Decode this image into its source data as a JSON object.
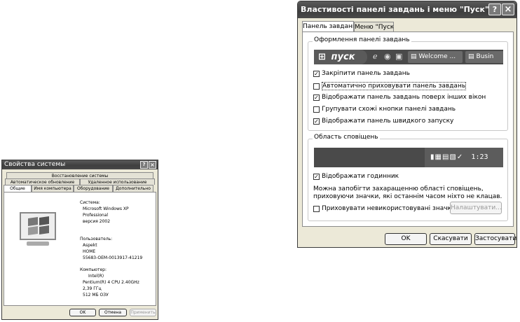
{
  "system_dialog": {
    "title": "Свойства системы",
    "title_buttons": {
      "help": "?",
      "close": "×"
    },
    "tabs_row1": [
      "Восстановление системы"
    ],
    "tabs_row2": [
      "Автоматическое обновление",
      "Удаленное использование"
    ],
    "tabs_row3": [
      "Общие",
      "Имя компьютера",
      "Оборудование",
      "Дополнительно"
    ],
    "system": {
      "heading": "Система:",
      "lines": [
        "Microsoft Windows XP",
        "Professional",
        "версия 2002"
      ]
    },
    "user": {
      "heading": "Пользователь:",
      "lines": [
        "Aspekt",
        "HOME",
        "55683-OEM-0013917-41219"
      ]
    },
    "computer": {
      "heading": "Компьютер:",
      "lines": [
        "Intel(R)",
        "Pentium(R) 4 CPU 2.40GHz",
        "2,39 ГГц",
        "512 МБ ОЗУ"
      ]
    },
    "buttons": {
      "ok": "OK",
      "cancel": "Отмена",
      "apply": "Применить"
    }
  },
  "taskbar_dialog": {
    "title": "Властивості панелі завдань і меню \"Пуск\"",
    "title_buttons": {
      "help": "?",
      "close": "×"
    },
    "tabs": [
      "Панель завдань",
      "Меню \"Пуск\""
    ],
    "appearance": {
      "legend": "Оформлення панелі завдань",
      "preview": {
        "start_label": "пуск",
        "task1": "Welcome ...",
        "task2": "Busin"
      },
      "options": [
        {
          "label": "Закріпити панель завдань",
          "checked": true
        },
        {
          "label": "Автоматично приховувати панель завдань",
          "checked": false
        },
        {
          "label": "Відображати панель завдань поверх інших вікон",
          "checked": true
        },
        {
          "label": "Групувати схожі кнопки панелі завдань",
          "checked": false
        },
        {
          "label": "Відображати панель швидкого запуску",
          "checked": true
        }
      ]
    },
    "notification": {
      "legend": "Область сповіщень",
      "clock": "1:23",
      "show_clock": {
        "label": "Відображати годинник",
        "checked": true
      },
      "description": "Можна запобігти захаращенню області сповіщень, приховуючи значки, які останнім часом ніхто не клацав.",
      "hide_icons": {
        "label": "Приховувати невикористовувані значки",
        "checked": false
      },
      "customize_button": "Налаштувати..."
    },
    "buttons": {
      "ok": "OK",
      "cancel": "Скасувати",
      "apply": "Застосувати"
    }
  }
}
